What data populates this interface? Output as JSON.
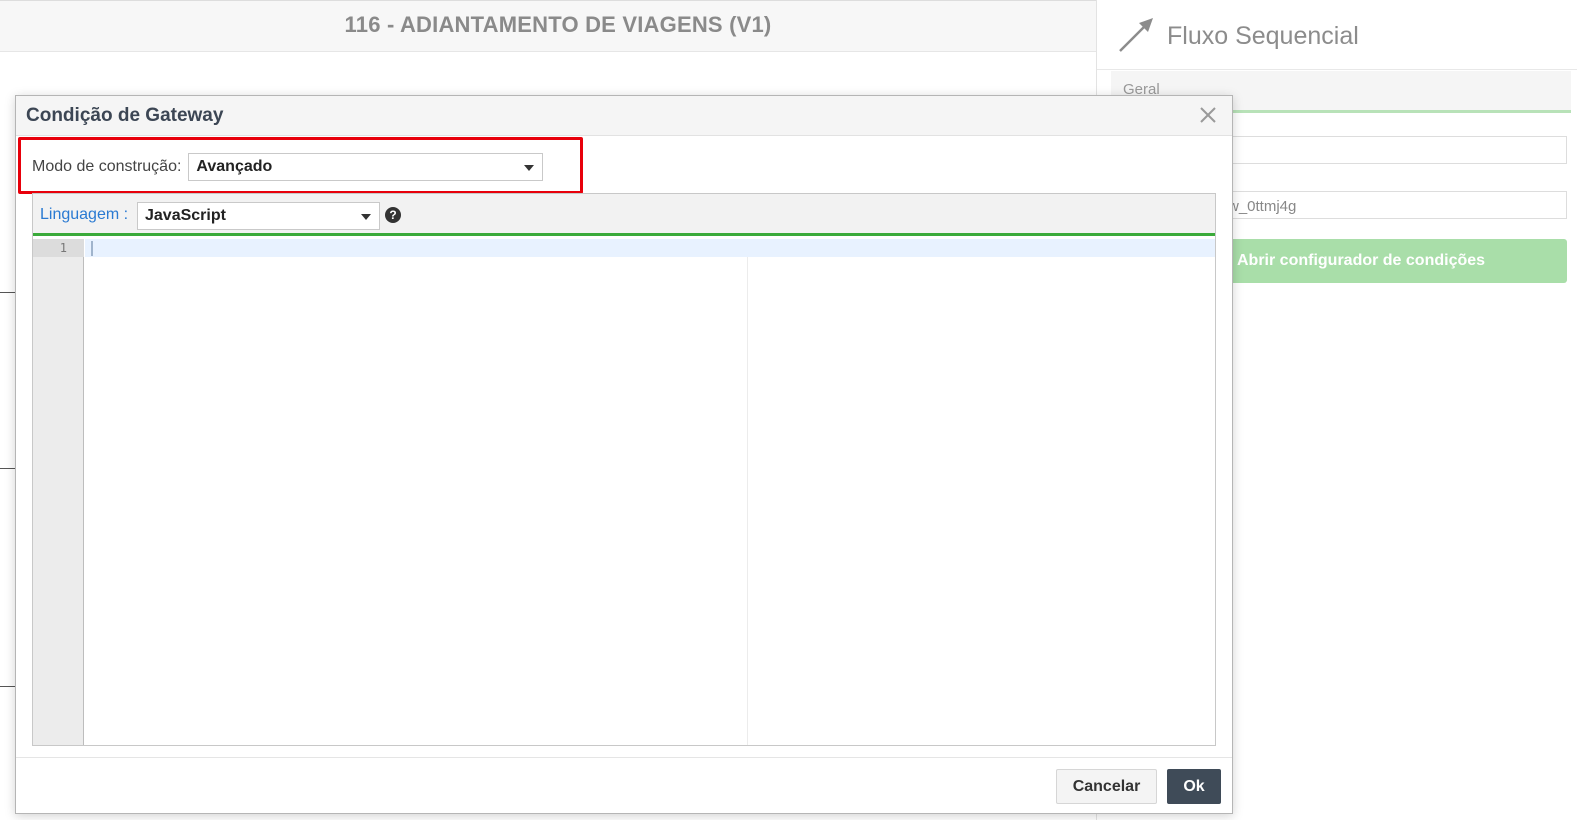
{
  "background": {
    "page_title": "116 - ADIANTAMENTO DE VIAGENS (V1)",
    "right_panel": {
      "title": "Fluxo Sequencial",
      "tab_label": "Geral",
      "id_value_partial": "w_0ttmj4g",
      "open_config_button": "Abrir configurador de condições"
    }
  },
  "modal": {
    "title": "Condição de Gateway",
    "build_mode": {
      "label": "Modo de construção:",
      "value": "Avançado"
    },
    "editor": {
      "language_label": "Linguagem :",
      "language_value": "JavaScript",
      "help_icon": "?",
      "line_numbers": [
        "1"
      ],
      "code": ""
    },
    "footer": {
      "cancel_label": "Cancelar",
      "ok_label": "Ok"
    }
  },
  "colors": {
    "highlight_border": "#e8000b",
    "editor_accent": "#3aaa3a",
    "ok_button": "#3f4b58",
    "language_label": "#2a7ad2",
    "config_button": "#a9dea9"
  }
}
